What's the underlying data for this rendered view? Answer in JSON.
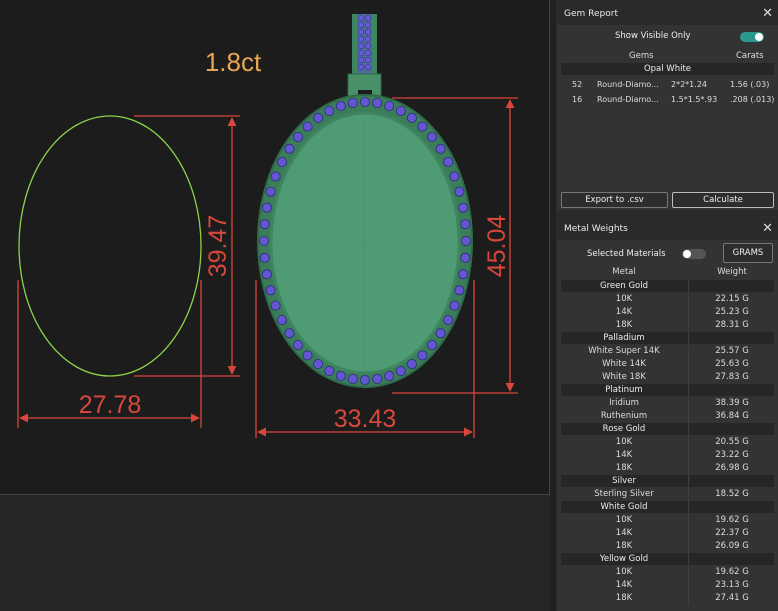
{
  "viewport": {
    "carat_label": "1.8ct",
    "dims": {
      "w1": "27.78",
      "h1": "39.47",
      "w2": "33.43",
      "h2": "45.04"
    }
  },
  "gem_report": {
    "title": "Gem Report",
    "show_visible_label": "Show Visible Only",
    "show_visible_on": true,
    "col_gems": "Gems",
    "col_carats": "Carats",
    "group": "Opal White",
    "rows": [
      {
        "count": "52",
        "name": "Round-Diamo...",
        "size": "2*2*1.24",
        "carats": "1.56 (.03)"
      },
      {
        "count": "16",
        "name": "Round-Diamo...",
        "size": "1.5*1.5*.93",
        "carats": ".208 (.013)"
      }
    ],
    "export_label": "Export to .csv",
    "calculate_label": "Calculate"
  },
  "metal_weights": {
    "title": "Metal Weights",
    "selected_label": "Selected Materials",
    "selected_on": false,
    "grams_label": "GRAMS",
    "col_metal": "Metal",
    "col_weight": "Weight",
    "groups": [
      {
        "name": "Green Gold",
        "rows": [
          [
            "10K",
            "22.15 G"
          ],
          [
            "14K",
            "25.23 G"
          ],
          [
            "18K",
            "28.31 G"
          ]
        ]
      },
      {
        "name": "Palladium",
        "rows": [
          [
            "White Super 14K",
            "25.57 G"
          ],
          [
            "White 14K",
            "25.63 G"
          ],
          [
            "White 18K",
            "27.83 G"
          ]
        ]
      },
      {
        "name": "Platinum",
        "rows": [
          [
            "Iridium",
            "38.39 G"
          ],
          [
            "Ruthenium",
            "36.84 G"
          ]
        ]
      },
      {
        "name": "Rose Gold",
        "rows": [
          [
            "10K",
            "20.55 G"
          ],
          [
            "14K",
            "23.22 G"
          ],
          [
            "18K",
            "26.98 G"
          ]
        ]
      },
      {
        "name": "Silver",
        "rows": [
          [
            "Sterling Silver",
            "18.52 G"
          ]
        ]
      },
      {
        "name": "White Gold",
        "rows": [
          [
            "10K",
            "19.62 G"
          ],
          [
            "14K",
            "22.37 G"
          ],
          [
            "18K",
            "26.09 G"
          ]
        ]
      },
      {
        "name": "Yellow Gold",
        "rows": [
          [
            "10K",
            "19.62 G"
          ],
          [
            "14K",
            "23.13 G"
          ],
          [
            "18K",
            "27.41 G"
          ]
        ]
      }
    ]
  }
}
